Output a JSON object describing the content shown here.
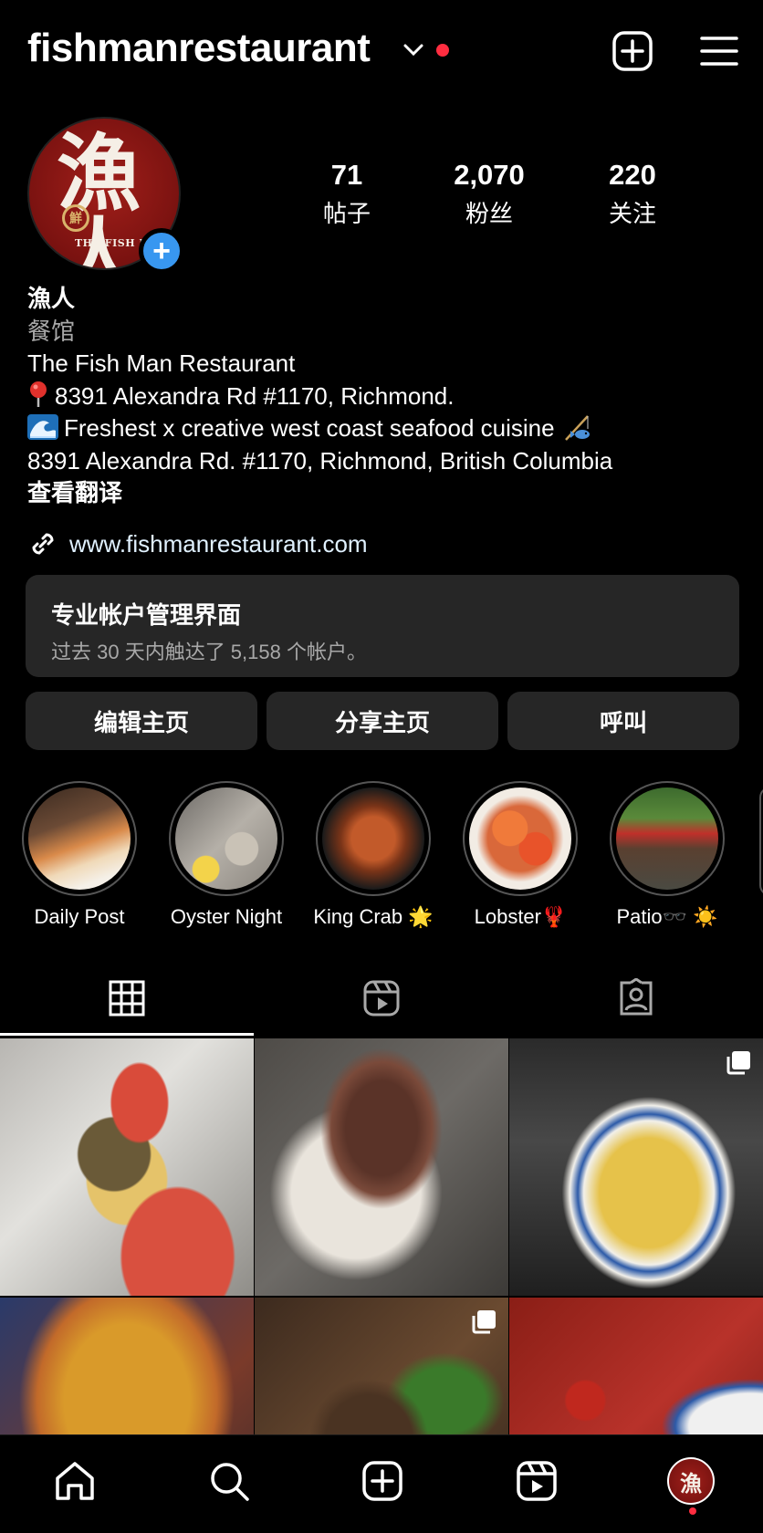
{
  "header": {
    "username": "fishmanrestaurant"
  },
  "profile": {
    "avatar_title": "漁人",
    "avatar_seal": "鮮",
    "avatar_text": "THE FISH MAN",
    "stats": [
      {
        "value": "71",
        "label": "帖子"
      },
      {
        "value": "2,070",
        "label": "粉丝"
      },
      {
        "value": "220",
        "label": "关注"
      }
    ]
  },
  "bio": {
    "name": "漁人",
    "category": "餐馆",
    "line1": "The Fish Man Restaurant",
    "line2": "8391 Alexandra Rd #1170, Richmond.",
    "line3": "Freshest x creative west coast seafood cuisine",
    "address": "8391 Alexandra Rd. #1170, Richmond, British Columbia",
    "translate": "查看翻译",
    "link": "www.fishmanrestaurant.com"
  },
  "dashboard": {
    "title": "专业帐户管理界面",
    "subtitle": "过去 30 天内触达了 5,158 个帐户。"
  },
  "buttons": {
    "edit": "编辑主页",
    "share": "分享主页",
    "call": "呼叫"
  },
  "highlights": [
    {
      "label": "Daily Post"
    },
    {
      "label": "Oyster Night"
    },
    {
      "label": "King Crab 🌟"
    },
    {
      "label": "Lobster🦞"
    },
    {
      "label": "Patio🕶️ ☀️"
    }
  ],
  "colors": {
    "background": "#000000",
    "surface": "#262626",
    "accent_blue": "#3897f0",
    "notification_red": "#ff2d40",
    "muted_text": "#a8a8a8"
  },
  "icons": {
    "top": [
      "chevron-down-icon",
      "notification-dot",
      "create-plus-icon",
      "menu-icon"
    ],
    "tabs": [
      "grid-icon",
      "reels-icon",
      "tagged-icon"
    ],
    "nav": [
      "home-icon",
      "search-icon",
      "create-icon",
      "reels-icon",
      "profile-avatar"
    ]
  }
}
